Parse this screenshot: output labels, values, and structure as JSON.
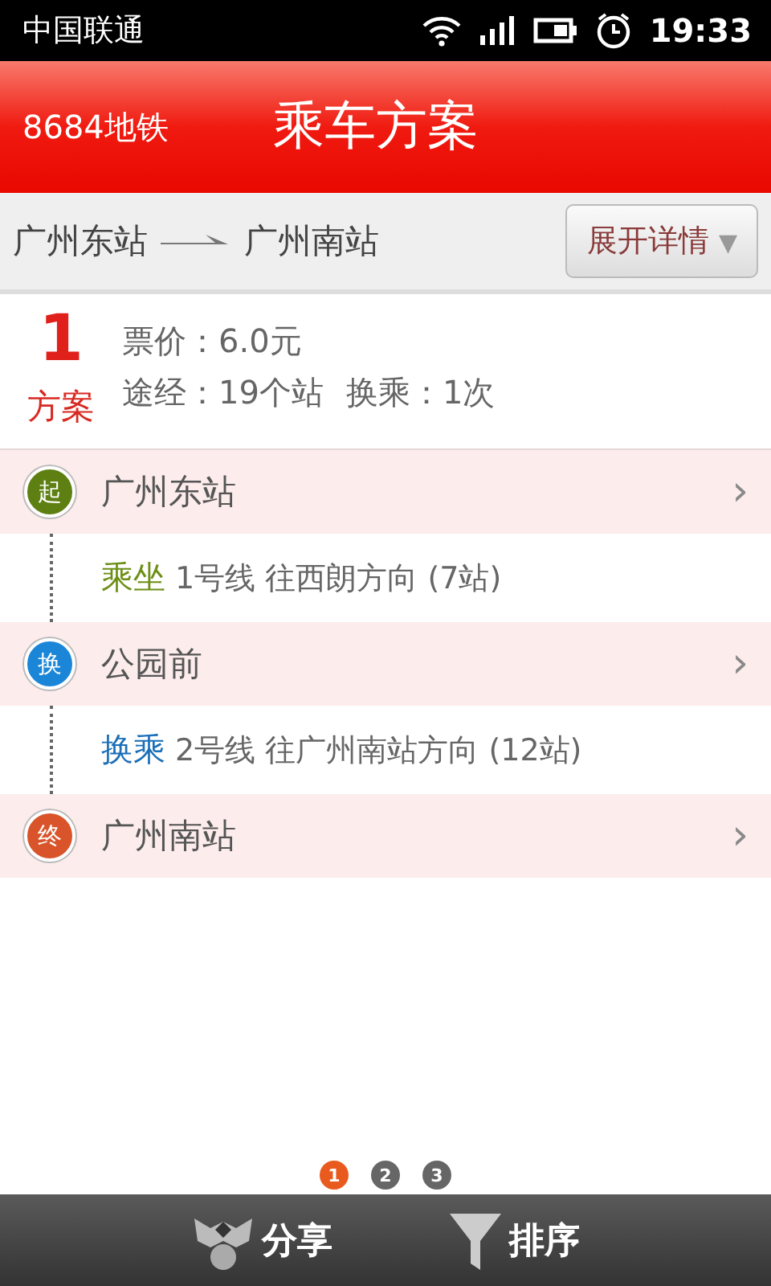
{
  "status_bar": {
    "carrier": "中国联通",
    "time": "19:33"
  },
  "header": {
    "app_name": "8684地铁",
    "title": "乘车方案"
  },
  "route": {
    "from": "广州东站",
    "to": "广州南站",
    "details_button": "展开详情",
    "details_caret": "▼"
  },
  "plan": {
    "number": "1",
    "label": "方案",
    "fare": "票价：6.0元",
    "via": "途经：19个站",
    "transfers": "换乘：1次"
  },
  "steps": [
    {
      "kind": "station",
      "badge": "起",
      "color": "#5e7f12",
      "name": "广州东站",
      "chevron": "›"
    },
    {
      "kind": "ride",
      "verb": "乘坐",
      "color": "#6d8f16",
      "text": "1号线 往西朗方向 (7站)"
    },
    {
      "kind": "station",
      "badge": "换",
      "color": "#1b86d8",
      "name": "公园前",
      "chevron": "›"
    },
    {
      "kind": "ride",
      "verb": "换乘",
      "color": "#1c6fb8",
      "text": "2号线 往广州南站方向 (12站)"
    },
    {
      "kind": "station",
      "badge": "终",
      "color": "#d9542a",
      "name": "广州南站",
      "chevron": "›"
    }
  ],
  "pages": [
    {
      "label": "1",
      "selected": true
    },
    {
      "label": "2",
      "selected": false
    },
    {
      "label": "3",
      "selected": false
    }
  ],
  "toolbar": [
    {
      "kind": "share",
      "label": "分享"
    },
    {
      "kind": "sort",
      "label": "排序"
    }
  ]
}
